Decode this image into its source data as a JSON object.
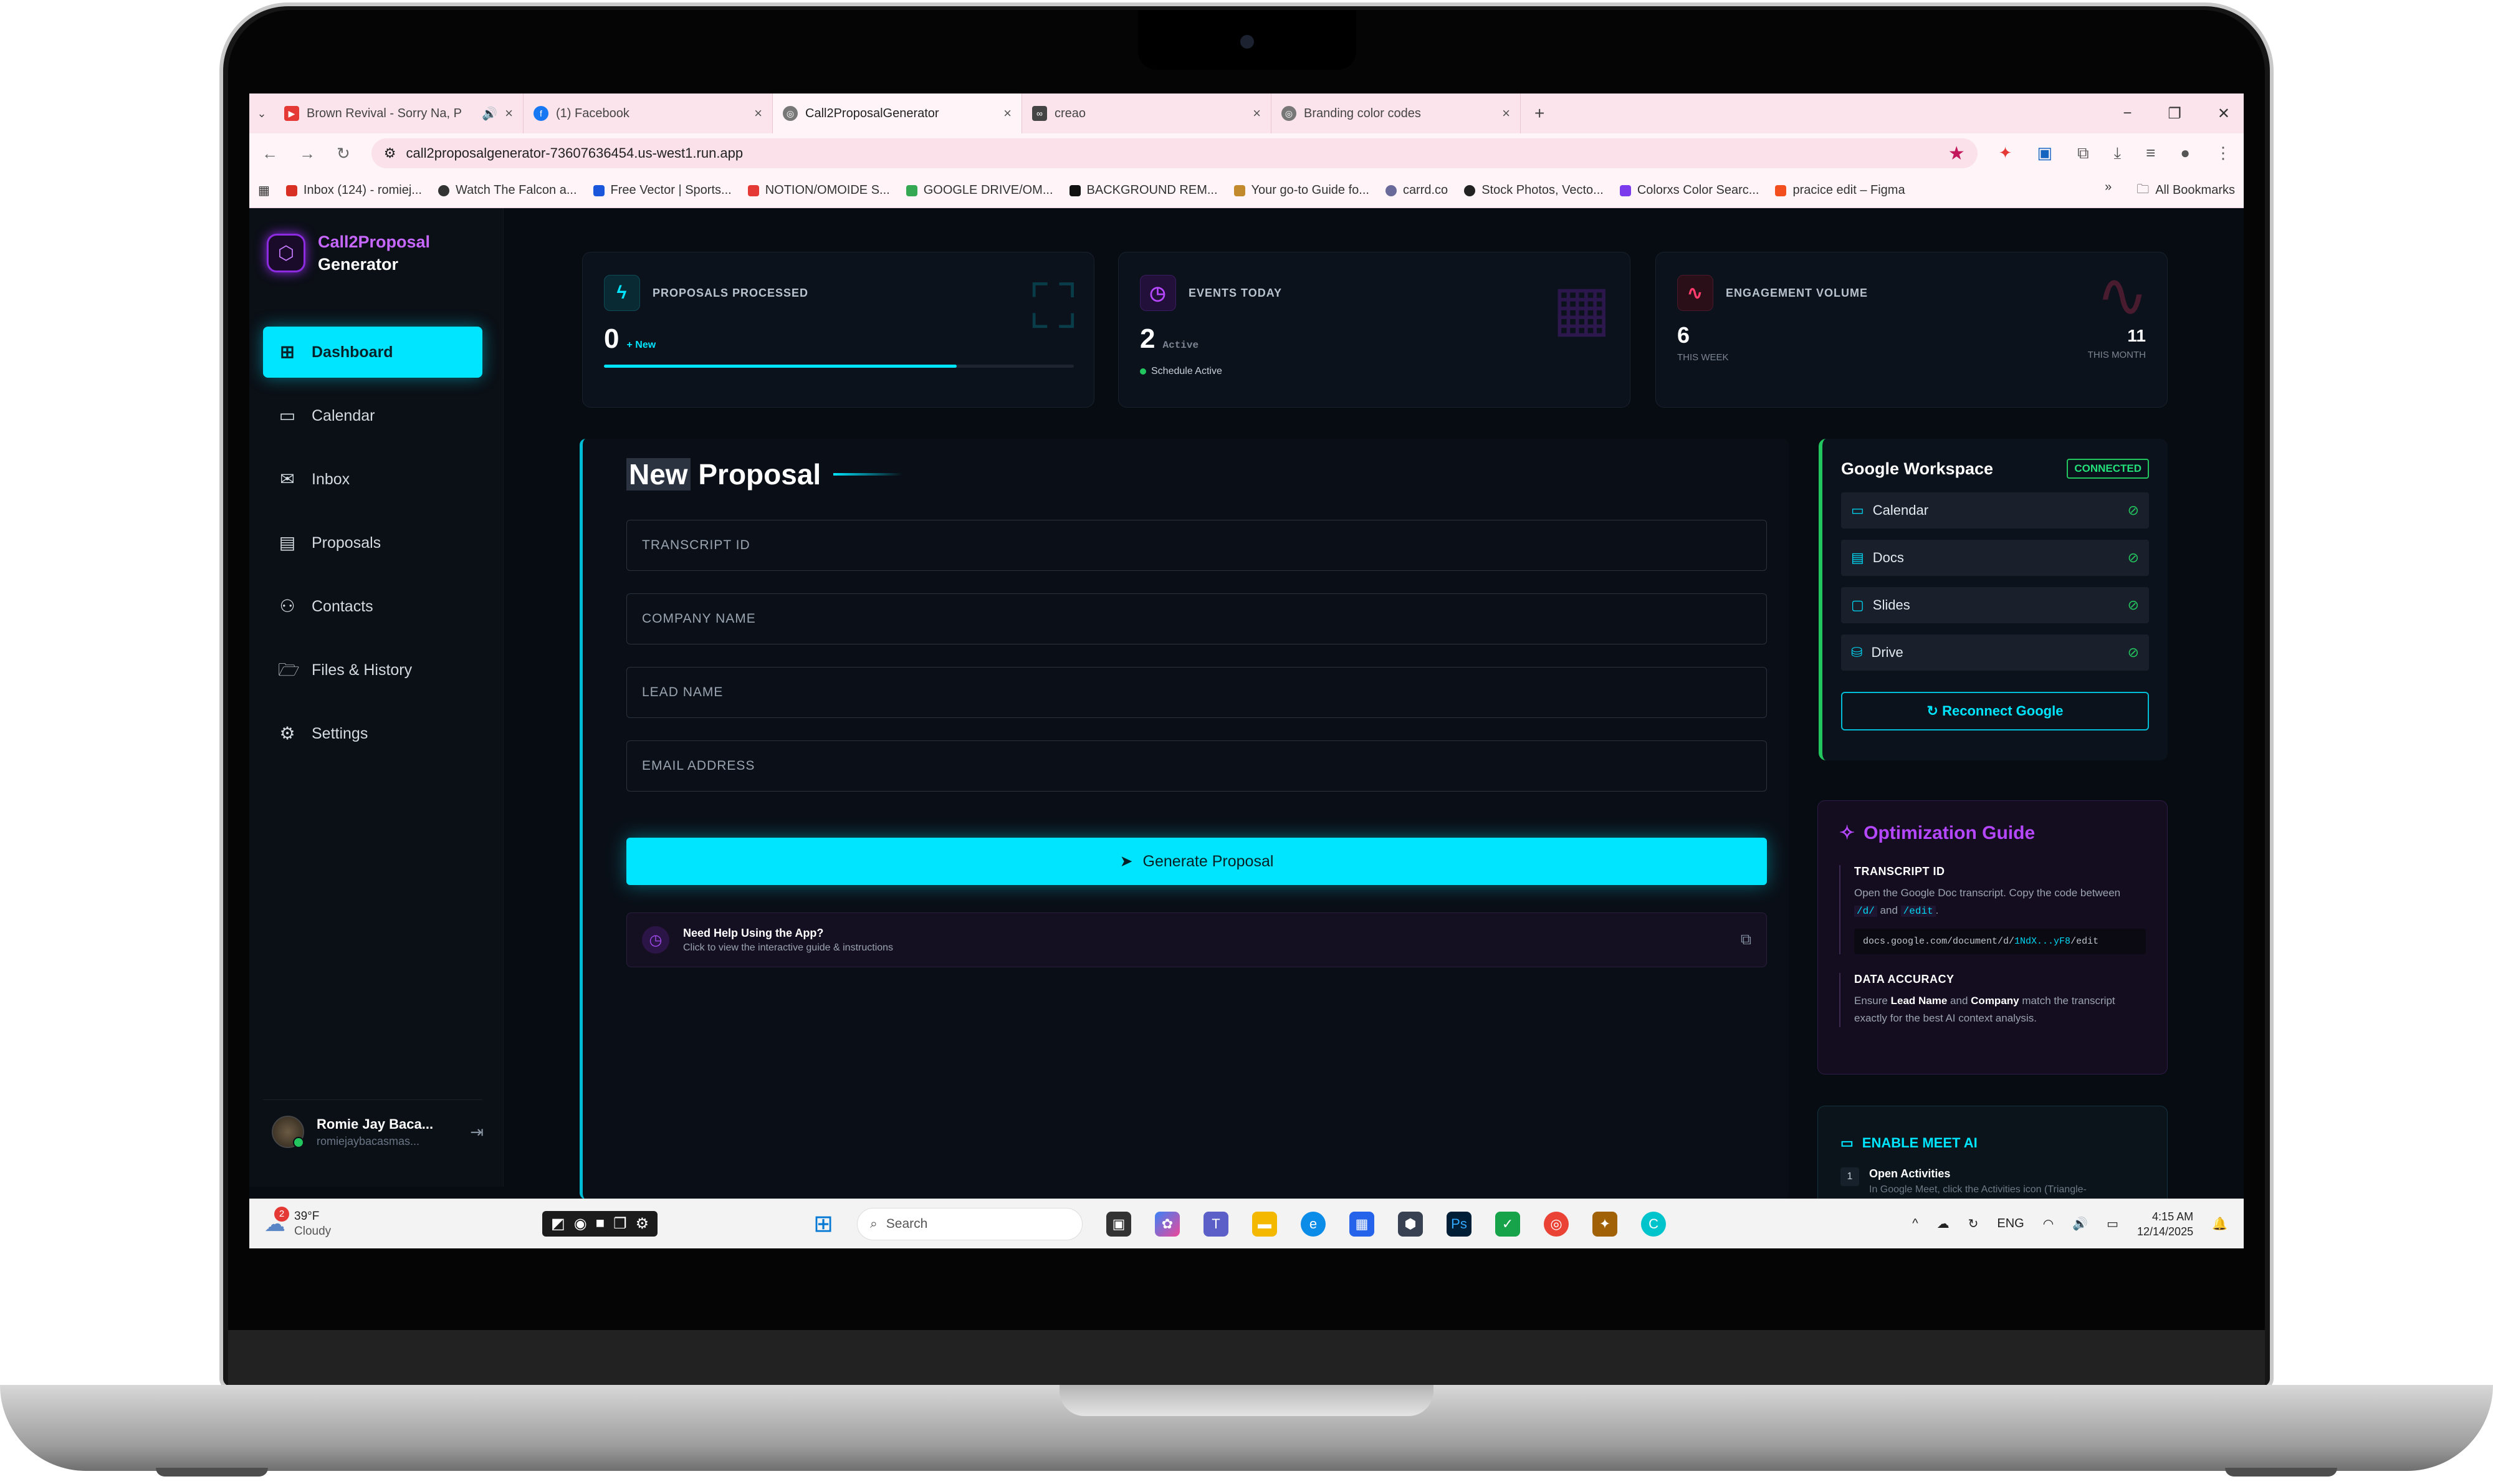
{
  "browser": {
    "tabs": [
      {
        "title": "Brown Revival - Sorry Na, P",
        "icon": "youtube-icon",
        "color": "#e53935"
      },
      {
        "title": "(1) Facebook",
        "icon": "facebook-icon",
        "color": "#1877f2"
      },
      {
        "title": "Call2ProposalGenerator",
        "icon": "web-icon",
        "color": "#777777"
      },
      {
        "title": "creao",
        "icon": "creao-icon",
        "color": "#444444"
      },
      {
        "title": "Branding color codes",
        "icon": "web-icon",
        "color": "#777777"
      }
    ],
    "url": "call2proposalgenerator-73607636454.us-west1.run.app",
    "bookmarks": [
      {
        "label": "Inbox (124) - romiej...",
        "color": "#d93025"
      },
      {
        "label": "Watch The Falcon a...",
        "color": "#333333"
      },
      {
        "label": "Free Vector | Sports...",
        "color": "#1a56db"
      },
      {
        "label": "NOTION/OMOIDE S...",
        "color": "#e53935"
      },
      {
        "label": "GOOGLE DRIVE/OM...",
        "color": "#34a853"
      },
      {
        "label": "BACKGROUND REM...",
        "color": "#111111"
      },
      {
        "label": "Your go-to Guide fo...",
        "color": "#c28a2c"
      },
      {
        "label": "carrd.co",
        "color": "#6a6a9a"
      },
      {
        "label": "Stock Photos, Vecto...",
        "color": "#222222"
      },
      {
        "label": "Colorxs Color Searc...",
        "color": "#7c3aed"
      },
      {
        "label": "pracice edit – Figma",
        "color": "#f24e1e"
      }
    ],
    "all_bookmarks": "All Bookmarks"
  },
  "sidebar": {
    "brand_line1": "Call2Proposal",
    "brand_line2": "Generator",
    "items": [
      {
        "label": "Dashboard",
        "icon": "grid-icon"
      },
      {
        "label": "Calendar",
        "icon": "calendar-icon"
      },
      {
        "label": "Inbox",
        "icon": "mail-icon"
      },
      {
        "label": "Proposals",
        "icon": "document-icon"
      },
      {
        "label": "Contacts",
        "icon": "users-icon"
      },
      {
        "label": "Files & History",
        "icon": "folder-icon"
      },
      {
        "label": "Settings",
        "icon": "gear-icon"
      }
    ],
    "user_name": "Romie Jay Baca...",
    "user_email": "romiejaybacasmas..."
  },
  "stats": {
    "proposals": {
      "label": "PROPOSALS PROCESSED",
      "value": "0",
      "sub": "+ New",
      "progress": 0.75
    },
    "events": {
      "label": "EVENTS TODAY",
      "value": "2",
      "sub": "Active",
      "status": "Schedule Active"
    },
    "engagement": {
      "label": "ENGAGEMENT VOLUME",
      "week_value": "6",
      "week_label": "THIS WEEK",
      "month_value": "11",
      "month_label": "THIS MONTH"
    }
  },
  "proposal": {
    "title_a": "New",
    "title_b": "Proposal",
    "fields": {
      "transcript": "TRANSCRIPT ID",
      "company": "COMPANY NAME",
      "lead": "LEAD NAME",
      "email": "EMAIL ADDRESS"
    },
    "generate_label": "Generate Proposal",
    "help_title": "Need Help Using the App?",
    "help_sub": "Click to view the interactive guide & instructions"
  },
  "workspace": {
    "title": "Google Workspace",
    "badge": "CONNECTED",
    "services": [
      "Calendar",
      "Docs",
      "Slides",
      "Drive"
    ],
    "reconnect": "Reconnect Google"
  },
  "guide": {
    "title": "Optimization Guide",
    "s1_title": "TRANSCRIPT ID",
    "s1_text_a": "Open the Google Doc transcript. Copy the code between",
    "s1_code1": "/d/",
    "s1_and": "and",
    "s1_code2": "/edit",
    "s1_example_a": "docs.google.com/document/d/",
    "s1_example_b": "1NdX...yF8",
    "s1_example_c": "/edit",
    "s2_title": "DATA ACCURACY",
    "s2_text_a": "Ensure",
    "s2_bold1": "Lead Name",
    "s2_and": "and",
    "s2_bold2": "Company",
    "s2_text_b": "match the transcript exactly for the best AI context analysis."
  },
  "meet": {
    "title": "ENABLE MEET AI",
    "step_num": "1",
    "step_title": "Open Activities",
    "step_text": "In Google Meet, click the Activities icon (Triangle-"
  },
  "taskbar": {
    "temp": "39°F",
    "condition": "Cloudy",
    "notif": "2",
    "search": "Search",
    "lang": "ENG",
    "time": "4:15 AM",
    "date": "12/14/2025"
  }
}
